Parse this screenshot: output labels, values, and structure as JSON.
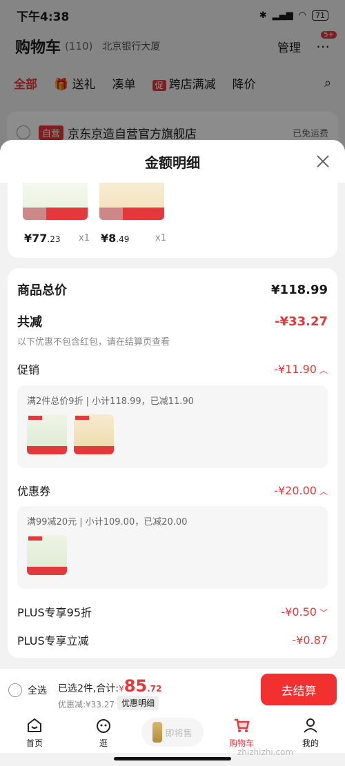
{
  "status_bar": {
    "time": "下午4:38",
    "battery": "71"
  },
  "header": {
    "title": "购物车",
    "count": "(110)",
    "address": "北京银行大厦",
    "manage": "管理",
    "badge": "5+"
  },
  "tabs": [
    {
      "label": "全部"
    },
    {
      "label": "送礼"
    },
    {
      "label": "凑单"
    },
    {
      "label": "跨店满减",
      "tag": "促"
    },
    {
      "label": "降价"
    }
  ],
  "store": {
    "tag": "自营",
    "name": "京东京造自营官方旗舰店",
    "shipping": "已免运费"
  },
  "sheet": {
    "title": "金额明细",
    "products": [
      {
        "price_int": "¥77",
        "price_dec": ".23",
        "qty": "x1"
      },
      {
        "price_int": "¥8",
        "price_dec": ".49",
        "qty": "x1"
      }
    ],
    "total_label": "商品总价",
    "total_value": "¥118.99",
    "discount_label": "共减",
    "discount_value": "-¥33.27",
    "discount_note": "以下优惠不包含红包，请在结算页查看",
    "promo_label": "促销",
    "promo_value": "-¥11.90",
    "promo_text": "满2件总价9折 | 小计118.99，已减11.90",
    "coupon_label": "优惠券",
    "coupon_value": "-¥20.00",
    "coupon_text": "满99减20元 | 小计109.00，已减20.00",
    "plus95_label": "PLUS专享95折",
    "plus95_value": "-¥0.50",
    "plusoff_label": "PLUS专享立减",
    "plusoff_value": "-¥0.87"
  },
  "bottom": {
    "select_all": "全选",
    "selected": "已选2件,合计:",
    "currency": "¥",
    "total_int": "85",
    "total_dec": ".72",
    "saved": "优惠减:¥33.27",
    "detail_btn": "优惠明细",
    "checkout": "去结算"
  },
  "nav": [
    {
      "label": "首页"
    },
    {
      "label": "逛"
    },
    {
      "label": "即将售"
    },
    {
      "label": "购物车"
    },
    {
      "label": "我的"
    }
  ],
  "watermark": "zhizhizhi.com"
}
